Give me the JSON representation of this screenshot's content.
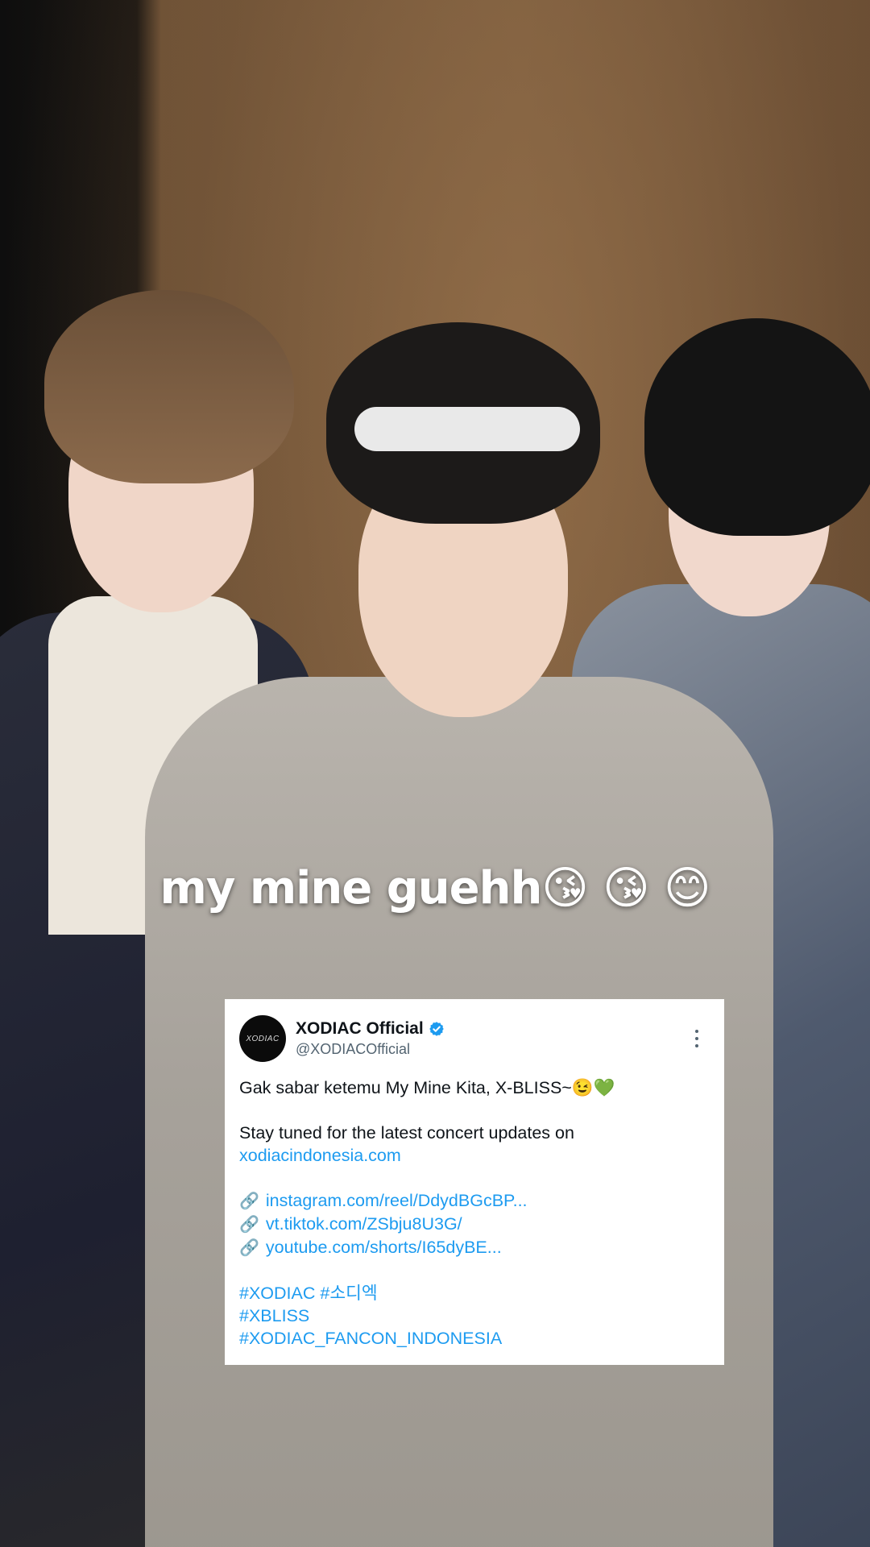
{
  "caption": {
    "text": "my mine guehh😘 😘 😊"
  },
  "tweet": {
    "avatar_text": "XODIAC",
    "display_name": "XODIAC Official",
    "verified": true,
    "handle": "@XODIACOfficial",
    "line1": "Gak sabar ketemu My Mine Kita, X-BLISS~😉💚",
    "line2": "Stay tuned for the latest concert updates on",
    "site_link": "xodiacindonesia.com",
    "links": [
      "instagram.com/reel/DdydBGcBP...",
      "vt.tiktok.com/ZSbju8U3G/",
      "youtube.com/shorts/I65dyBE..."
    ],
    "link_icon": "🔗",
    "hashtags": [
      "#XODIAC #소디엑",
      "#XBLISS",
      "#XODIAC_FANCON_INDONESIA"
    ]
  },
  "colors": {
    "link": "#1d9bf0",
    "text": "#0f1419",
    "handle": "#536471",
    "verified": "#1d9bf0"
  },
  "icons": [
    "verified-badge-icon",
    "more-options-icon",
    "link-icon"
  ]
}
